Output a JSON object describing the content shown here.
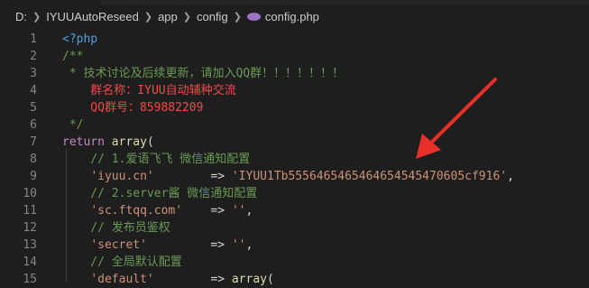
{
  "breadcrumb": {
    "drive": "D:",
    "folder1": "IYUUAutoReseed",
    "folder2": "app",
    "folder3": "config",
    "file": "config.php"
  },
  "editor": {
    "lines": [
      {
        "n": "1",
        "segs": [
          {
            "t": "<?php",
            "c": "k-tag"
          }
        ]
      },
      {
        "n": "2",
        "segs": [
          {
            "t": "/**",
            "c": "k-com"
          }
        ]
      },
      {
        "n": "3",
        "segs": [
          {
            "t": " * 技术讨论及后续更新，请加入QQ群！！！！！！！",
            "c": "k-com"
          }
        ]
      },
      {
        "n": "4",
        "segs": [
          {
            "t": "    群名称：IYUU自动辅种交流",
            "c": "k-red"
          }
        ]
      },
      {
        "n": "5",
        "segs": [
          {
            "t": "    QQ群号：859882209",
            "c": "k-red"
          }
        ]
      },
      {
        "n": "6",
        "segs": [
          {
            "t": " */",
            "c": "k-com"
          }
        ]
      },
      {
        "n": "7",
        "segs": [
          {
            "t": "return",
            "c": "k-kw"
          },
          {
            "t": " ",
            "c": "k-op"
          },
          {
            "t": "array",
            "c": "k-fn"
          },
          {
            "t": "(",
            "c": "k-op"
          }
        ]
      },
      {
        "n": "8",
        "segs": [
          {
            "t": "    // 1.爱语飞飞 微信通知配置",
            "c": "k-com"
          }
        ]
      },
      {
        "n": "9",
        "segs": [
          {
            "t": "    ",
            "c": "k-op"
          },
          {
            "t": "'iyuu.cn'",
            "c": "k-str"
          },
          {
            "t": "        => ",
            "c": "k-op"
          },
          {
            "t": "'IYUU1Tb5556465465464654545470605cf916'",
            "c": "k-str"
          },
          {
            "t": ",",
            "c": "k-op"
          }
        ]
      },
      {
        "n": "10",
        "segs": [
          {
            "t": "    // 2.server酱 微信通知配置",
            "c": "k-com"
          }
        ]
      },
      {
        "n": "11",
        "segs": [
          {
            "t": "    ",
            "c": "k-op"
          },
          {
            "t": "'sc.ftqq.com'",
            "c": "k-str"
          },
          {
            "t": "    => ",
            "c": "k-op"
          },
          {
            "t": "''",
            "c": "k-str"
          },
          {
            "t": ",",
            "c": "k-op"
          }
        ]
      },
      {
        "n": "12",
        "segs": [
          {
            "t": "    // 发布员鉴权",
            "c": "k-com"
          }
        ]
      },
      {
        "n": "13",
        "segs": [
          {
            "t": "    ",
            "c": "k-op"
          },
          {
            "t": "'secret'",
            "c": "k-str"
          },
          {
            "t": "         => ",
            "c": "k-op"
          },
          {
            "t": "''",
            "c": "k-str"
          },
          {
            "t": ",",
            "c": "k-op"
          }
        ]
      },
      {
        "n": "14",
        "segs": [
          {
            "t": "    // 全局默认配置",
            "c": "k-com"
          }
        ]
      },
      {
        "n": "15",
        "segs": [
          {
            "t": "    ",
            "c": "k-op"
          },
          {
            "t": "'default'",
            "c": "k-str"
          },
          {
            "t": "        => ",
            "c": "k-op"
          },
          {
            "t": "array",
            "c": "k-fn"
          },
          {
            "t": "(",
            "c": "k-op"
          }
        ]
      }
    ]
  },
  "colors": {
    "arrow": "#e8302a",
    "background": "#1e1e1e"
  }
}
